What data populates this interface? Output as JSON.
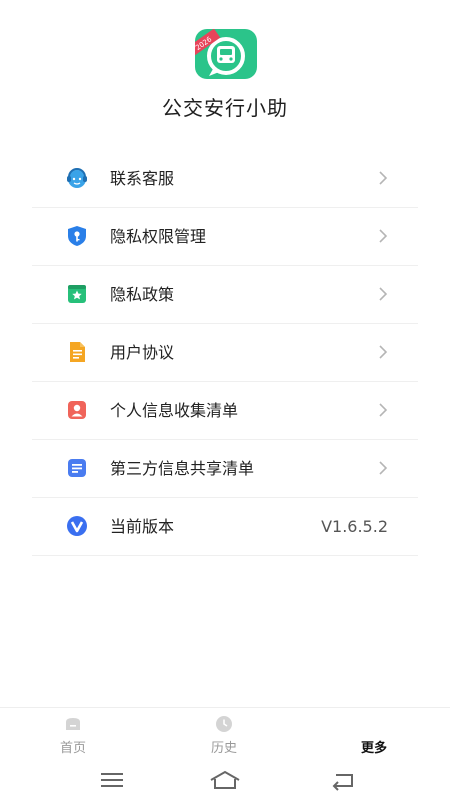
{
  "app": {
    "name": "公交安行小助",
    "logo_badge": "2026",
    "logo_icon": "bus-icon"
  },
  "menu": [
    {
      "label": "联系客服",
      "icon": "customer-service-icon",
      "color": "#3aa3e8",
      "chevron": true
    },
    {
      "label": "隐私权限管理",
      "icon": "shield-key-icon",
      "color": "#2a7fe8",
      "chevron": true
    },
    {
      "label": "隐私政策",
      "icon": "star-bookmark-icon",
      "color": "#27c07a",
      "chevron": true
    },
    {
      "label": "用户协议",
      "icon": "document-icon",
      "color": "#f5a623",
      "chevron": true
    },
    {
      "label": "个人信息收集清单",
      "icon": "person-card-icon",
      "color": "#f0645a",
      "chevron": true
    },
    {
      "label": "第三方信息共享清单",
      "icon": "list-document-icon",
      "color": "#4a7cf0",
      "chevron": true
    },
    {
      "label": "当前版本",
      "icon": "version-v-icon",
      "color": "#3a6ff0",
      "value": "V1.6.5.2",
      "chevron": false
    }
  ],
  "tabs": [
    {
      "label": "首页",
      "icon": "home-icon",
      "active": false
    },
    {
      "label": "历史",
      "icon": "clock-icon",
      "active": false
    },
    {
      "label": "更多",
      "icon": "",
      "active": true
    }
  ],
  "system_nav": [
    {
      "icon": "menu-lines-icon"
    },
    {
      "icon": "home-outline-icon"
    },
    {
      "icon": "back-icon"
    }
  ],
  "colors": {
    "brand": "#2bc48a",
    "badge": "#e8445a",
    "divider": "#efefef"
  }
}
